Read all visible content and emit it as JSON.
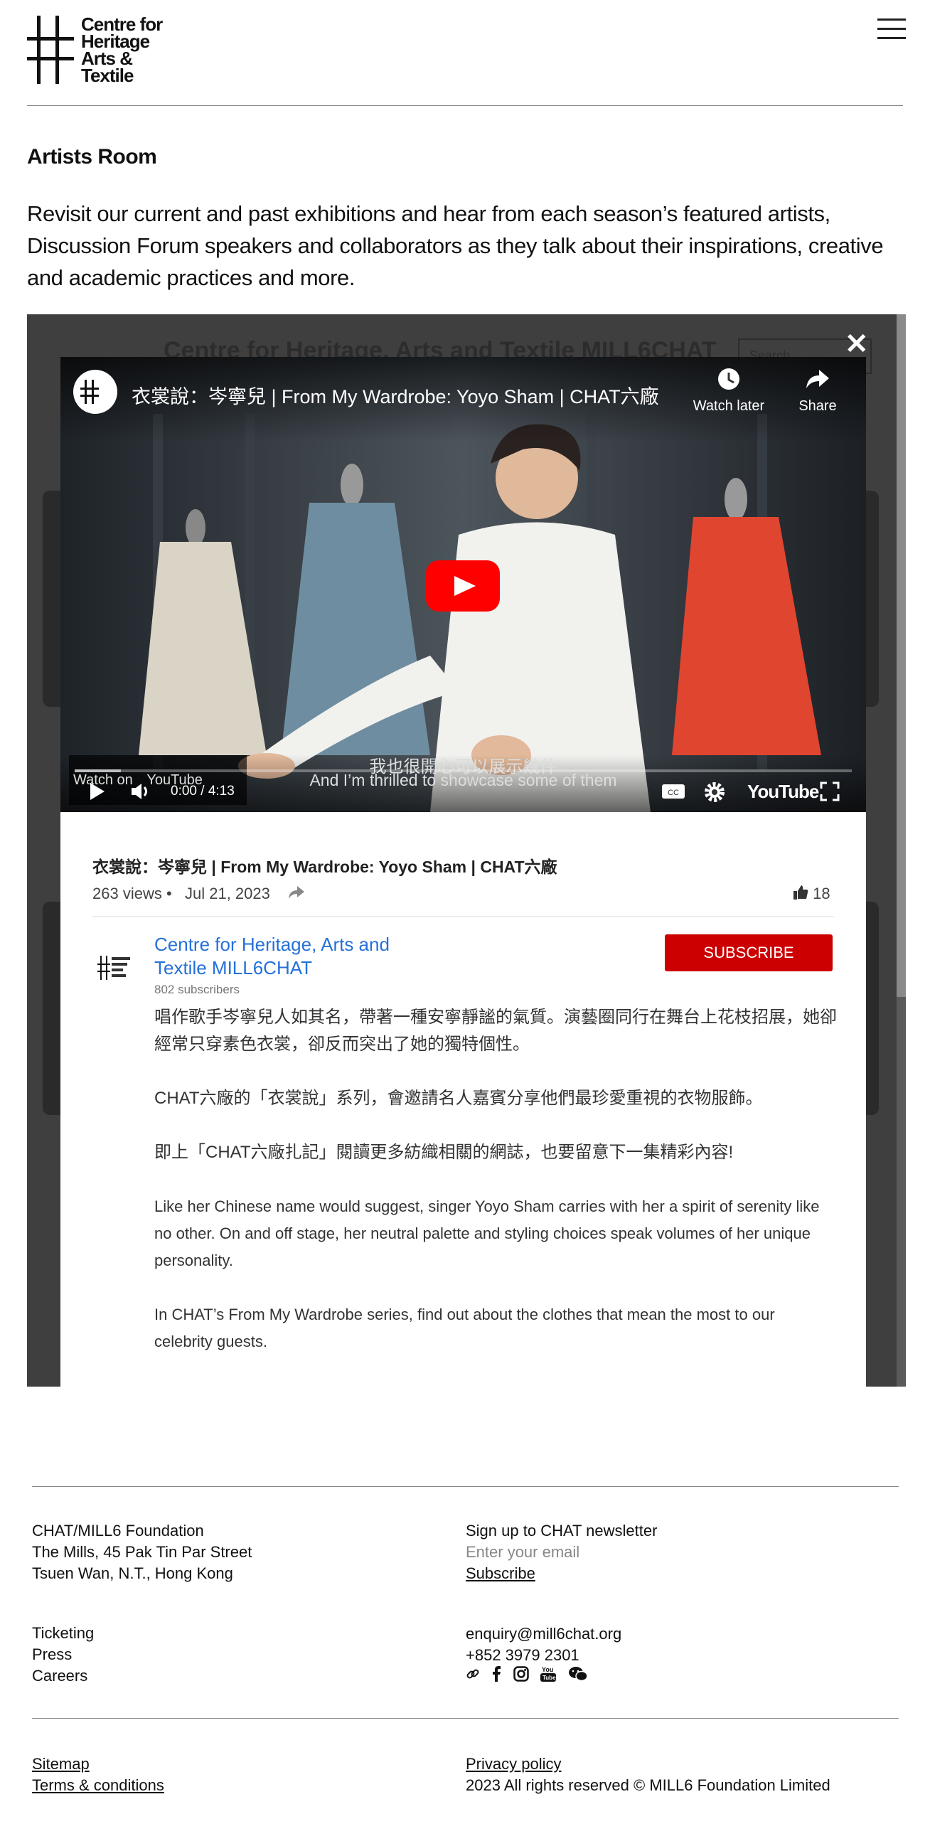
{
  "logo": {
    "lines": [
      "Centre for",
      "Heritage",
      "Arts &",
      "Textile"
    ]
  },
  "page": {
    "title": "Artists Room",
    "intro": "Revisit our current and past exhibitions and hear from each season’s featured artists, Discussion Forum speakers and collaborators as they talk about their inspirations, creative and academic practices and more."
  },
  "background": {
    "channel_title": "Centre for Heritage, Arts and Textile MILL6CHAT",
    "search_placeholder": "Search"
  },
  "player": {
    "title": "衣裳說：岑寧兒 | From My Wardrobe: Yoyo Sham | CHAT六廠",
    "watch_later": "Watch later",
    "share": "Share",
    "subtitle_zh": "我也很開心可以展示幾件",
    "subtitle_en": "And I’m thrilled to showcase some of them",
    "watch_on": "Watch on",
    "youtube": "YouTube",
    "time": "0:00 / 4:13",
    "progress": 0.0
  },
  "video_info": {
    "title": "衣裳說：岑寧兒 | From My Wardrobe: Yoyo Sham | CHAT六廠",
    "views": "263 views",
    "date": "Jul 21, 2023",
    "likes": "18",
    "channel_name": "Centre for Heritage, Arts and Textile MILL6CHAT",
    "subscribers": "802 subscribers",
    "subscribe_label": "SUBSCRIBE",
    "description": [
      "唱作歌手岑寧兒人如其名，帶著一種安寧靜謐的氣質。演藝圈同行在舞台上花枝招展，她卻經常只穿素色衣裳，卻反而突出了她的獨特個性。",
      "CHAT六廠的「衣裳說」系列，會邀請名人嘉賓分享他們最珍愛重視的衣物服飾。",
      "即上「CHAT六廠扎記」閱讀更多紡織相關的網誌，也要留意下一集精彩內容!",
      "Like her Chinese name would suggest, singer Yoyo Sham carries with her a spirit of serenity like no other. On and off stage, her neutral palette and styling choices speak volumes of her unique personality.",
      "In CHAT’s From My Wardrobe series, find out about the clothes that mean the most to our celebrity guests."
    ]
  },
  "footer": {
    "address": [
      "CHAT/MILL6 Foundation",
      "The Mills, 45 Pak Tin Par Street",
      "Tsuen Wan, N.T., Hong Kong"
    ],
    "newsletter_label": "Sign up to CHAT newsletter",
    "email_placeholder": "Enter your email",
    "subscribe_link": "Subscribe",
    "links": [
      "Ticketing",
      "Press",
      "Careers"
    ],
    "email": "enquiry@mill6chat.org",
    "phone": "+852 3979 2301",
    "social_icons": [
      "link-icon",
      "facebook-icon",
      "instagram-icon",
      "youtube-icon",
      "wechat-icon"
    ],
    "sitemap": "Sitemap",
    "terms": "Terms & conditions",
    "privacy": "Privacy policy",
    "copyright": "2023 All rights reserved © MILL6 Foundation Limited"
  }
}
